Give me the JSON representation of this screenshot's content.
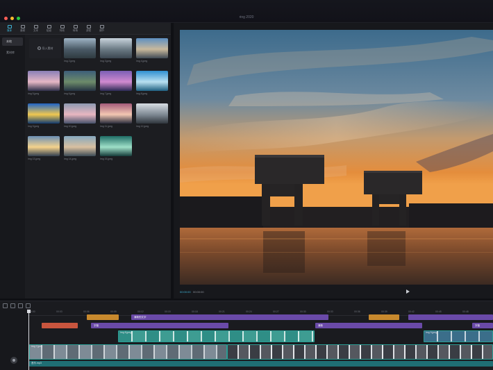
{
  "window": {
    "title": "ring 2020",
    "buttons": [
      {
        "name": "close",
        "color": "#ff5f57"
      },
      {
        "name": "minimize",
        "color": "#febc2e"
      },
      {
        "name": "zoom",
        "color": "#28c840"
      }
    ]
  },
  "toolbar": {
    "tools": [
      {
        "label": "媒体",
        "icon": "media-icon",
        "active": true
      },
      {
        "label": "音频",
        "icon": "audio-icon",
        "active": false
      },
      {
        "label": "文本",
        "icon": "text-icon",
        "active": false
      },
      {
        "label": "贴纸",
        "icon": "sticker-icon",
        "active": false
      },
      {
        "label": "特效",
        "icon": "effects-icon",
        "active": false
      },
      {
        "label": "转场",
        "icon": "transition-icon",
        "active": false
      },
      {
        "label": "滤镜",
        "icon": "filter-icon",
        "active": false
      },
      {
        "label": "调节",
        "icon": "adjust-icon",
        "active": false
      }
    ]
  },
  "side_nav": {
    "items": [
      {
        "label": "本地",
        "active": true
      },
      {
        "label": "素材库",
        "active": false
      }
    ]
  },
  "media": {
    "import_label": "导入素材",
    "items": [
      {
        "name": "img 2.jpeg"
      },
      {
        "name": "img 3.jpeg"
      },
      {
        "name": "img 4.jpeg"
      },
      {
        "name": "img 5.jpeg"
      },
      {
        "name": "img 6.jpeg"
      },
      {
        "name": "img 7.jpeg"
      },
      {
        "name": "img 8.jpeg"
      },
      {
        "name": "img 9.jpeg"
      },
      {
        "name": "img 10.jpeg"
      },
      {
        "name": "img 11.jpeg"
      },
      {
        "name": "img 12.jpeg"
      },
      {
        "name": "img 13.jpeg"
      },
      {
        "name": "img 14.jpeg"
      },
      {
        "name": "img 15.jpeg"
      }
    ]
  },
  "player": {
    "current_time": "00:00:00",
    "total_time": "00:00:00"
  },
  "timeline": {
    "ruler_ticks": [
      "00:00",
      "00:03",
      "00:06",
      "00:09",
      "00:12",
      "00:15",
      "00:18",
      "00:21",
      "00:24",
      "00:27",
      "00:30",
      "00:33",
      "00:36",
      "00:39",
      "00:42",
      "00:45",
      "00:48"
    ],
    "clips": {
      "text_row1": [
        "",
        "清新的文字",
        "",
        ""
      ],
      "text_row2": [
        "",
        "字幕",
        "清新",
        "字幕"
      ],
      "overlay_label": "img 8.jpeg",
      "overlay2_label": "img 9.jpeg",
      "main_label": "img 7.jpeg",
      "audio_label": "音乐.mp3"
    }
  }
}
